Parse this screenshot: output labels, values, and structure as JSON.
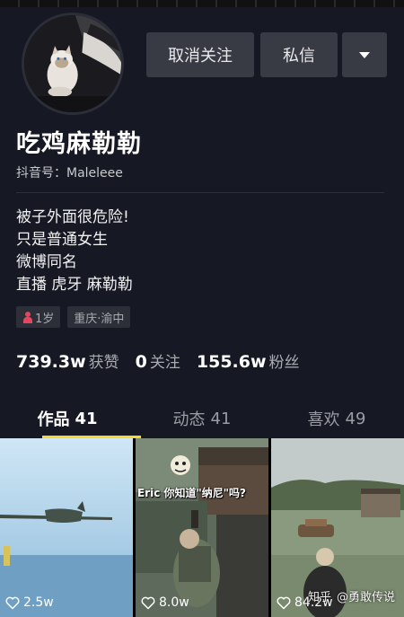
{
  "profile": {
    "name": "吃鸡麻勒勒",
    "douyin_id": "抖音号：Maleleee",
    "bio": [
      "被子外面很危险!",
      "只是普通女生",
      "微博同名",
      "直播 虎牙 麻勒勒"
    ],
    "tags": {
      "age": "1岁",
      "location": "重庆·渝中"
    }
  },
  "actions": {
    "unfollow": "取消关注",
    "message": "私信",
    "more_icon": "triangle-down-icon"
  },
  "stats": [
    {
      "num": "739.3w",
      "label": "获赞"
    },
    {
      "num": "0",
      "label": "关注"
    },
    {
      "num": "155.6w",
      "label": "粉丝"
    }
  ],
  "tabs": [
    {
      "label": "作品",
      "count": "41"
    },
    {
      "label": "动态",
      "count": "41"
    },
    {
      "label": "喜欢",
      "count": "49"
    }
  ],
  "videos": [
    {
      "likes": "2.5w"
    },
    {
      "likes": "8.0w",
      "caption": "Eric 你知道\"纳尼\"吗?"
    },
    {
      "likes": "84.2w"
    }
  ],
  "watermark": {
    "source": "知乎",
    "author": "@勇敢传说"
  },
  "colors": {
    "background": "#161823",
    "button": "#393b44",
    "accent": "#fbd534",
    "female": "#e3475f"
  }
}
